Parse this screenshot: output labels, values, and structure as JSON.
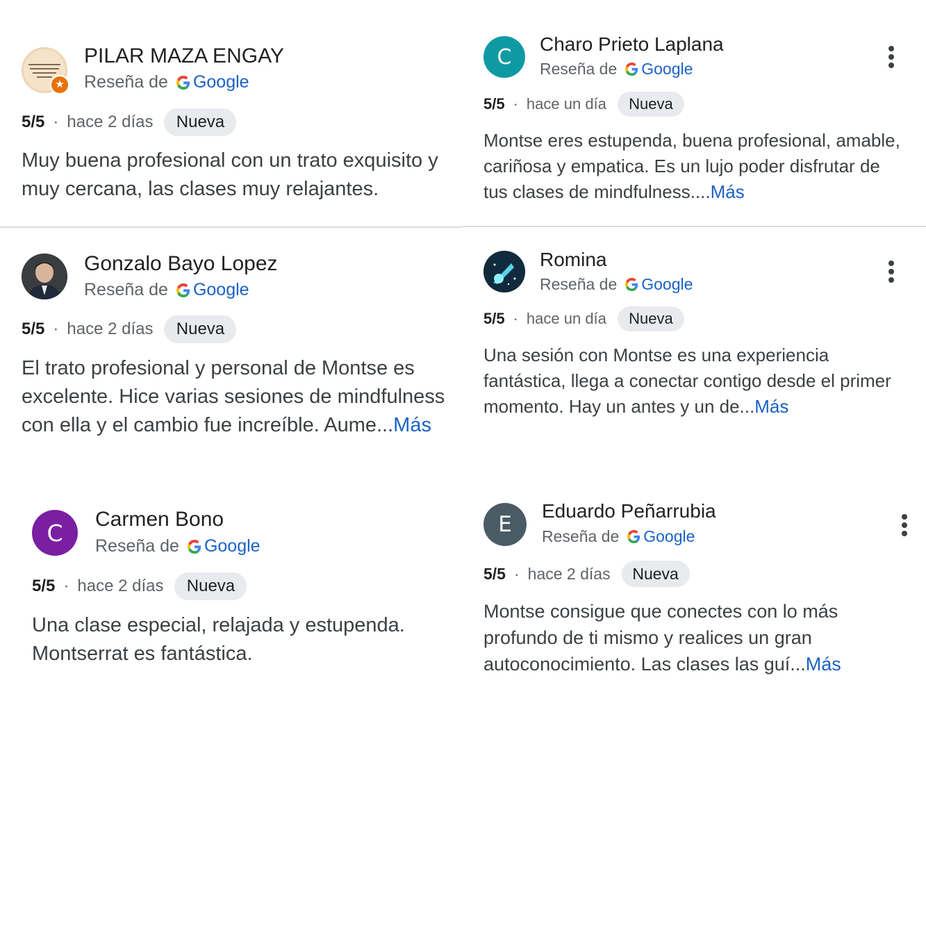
{
  "common": {
    "source_prefix": "Reseña de",
    "source_brand": "Google",
    "more_label": "Más",
    "dot": "·"
  },
  "colors": {
    "google_blue": "#4285F4",
    "google_red": "#EA4335",
    "google_yellow": "#FBBC05",
    "google_green": "#34A853",
    "link": "#1a62c6",
    "avatar_teal": "#0f9aa3",
    "avatar_purple": "#7b1fa2",
    "avatar_slate": "#4a5b66"
  },
  "reviews": [
    {
      "name": "PILAR MAZA ENGAY",
      "avatar_icon": "quote-photo-avatar",
      "rating": "5/5",
      "time": "hace 2 días",
      "badge": "Nueva",
      "text": "Muy buena profesional con un trato exquisito y muy cercana, las clases muy relajantes.",
      "truncated": false
    },
    {
      "name": "Charo Prieto Laplana",
      "avatar_letter": "C",
      "rating": "5/5",
      "time": "hace un día",
      "badge": "Nueva",
      "text": "Montse eres estupenda, buena profesional, amable, cariñosa y empatica. Es un lujo poder disfrutar de tus clases de mindfulness....",
      "truncated": true
    },
    {
      "name": "Gonzalo Bayo Lopez",
      "avatar_icon": "person-photo-avatar",
      "rating": "5/5",
      "time": "hace 2 días",
      "badge": "Nueva",
      "text": "El trato profesional y personal de Montse es excelente. Hice varias sesiones de mindfulness con ella y el cambio fue increíble. Aume...",
      "truncated": true
    },
    {
      "name": "Romina",
      "avatar_icon": "comet-avatar",
      "rating": "5/5",
      "time": "hace un día",
      "badge": "Nueva",
      "text": "Una sesión con Montse es una experiencia fantástica, llega a conectar contigo desde el primer momento. Hay un antes y un de...",
      "truncated": true
    },
    {
      "name": "Carmen Bono",
      "avatar_letter": "C",
      "rating": "5/5",
      "time": "hace 2 días",
      "badge": "Nueva",
      "text": "Una clase especial, relajada y estupenda. Montserrat es fantástica.",
      "truncated": false
    },
    {
      "name": "Eduardo Peñarrubia",
      "avatar_letter": "E",
      "rating": "5/5",
      "time": "hace 2 días",
      "badge": "Nueva",
      "text": "Montse consigue que conectes con lo más profundo de ti mismo y realices un gran autoconocimiento. Las clases las guí...",
      "truncated": true
    }
  ]
}
